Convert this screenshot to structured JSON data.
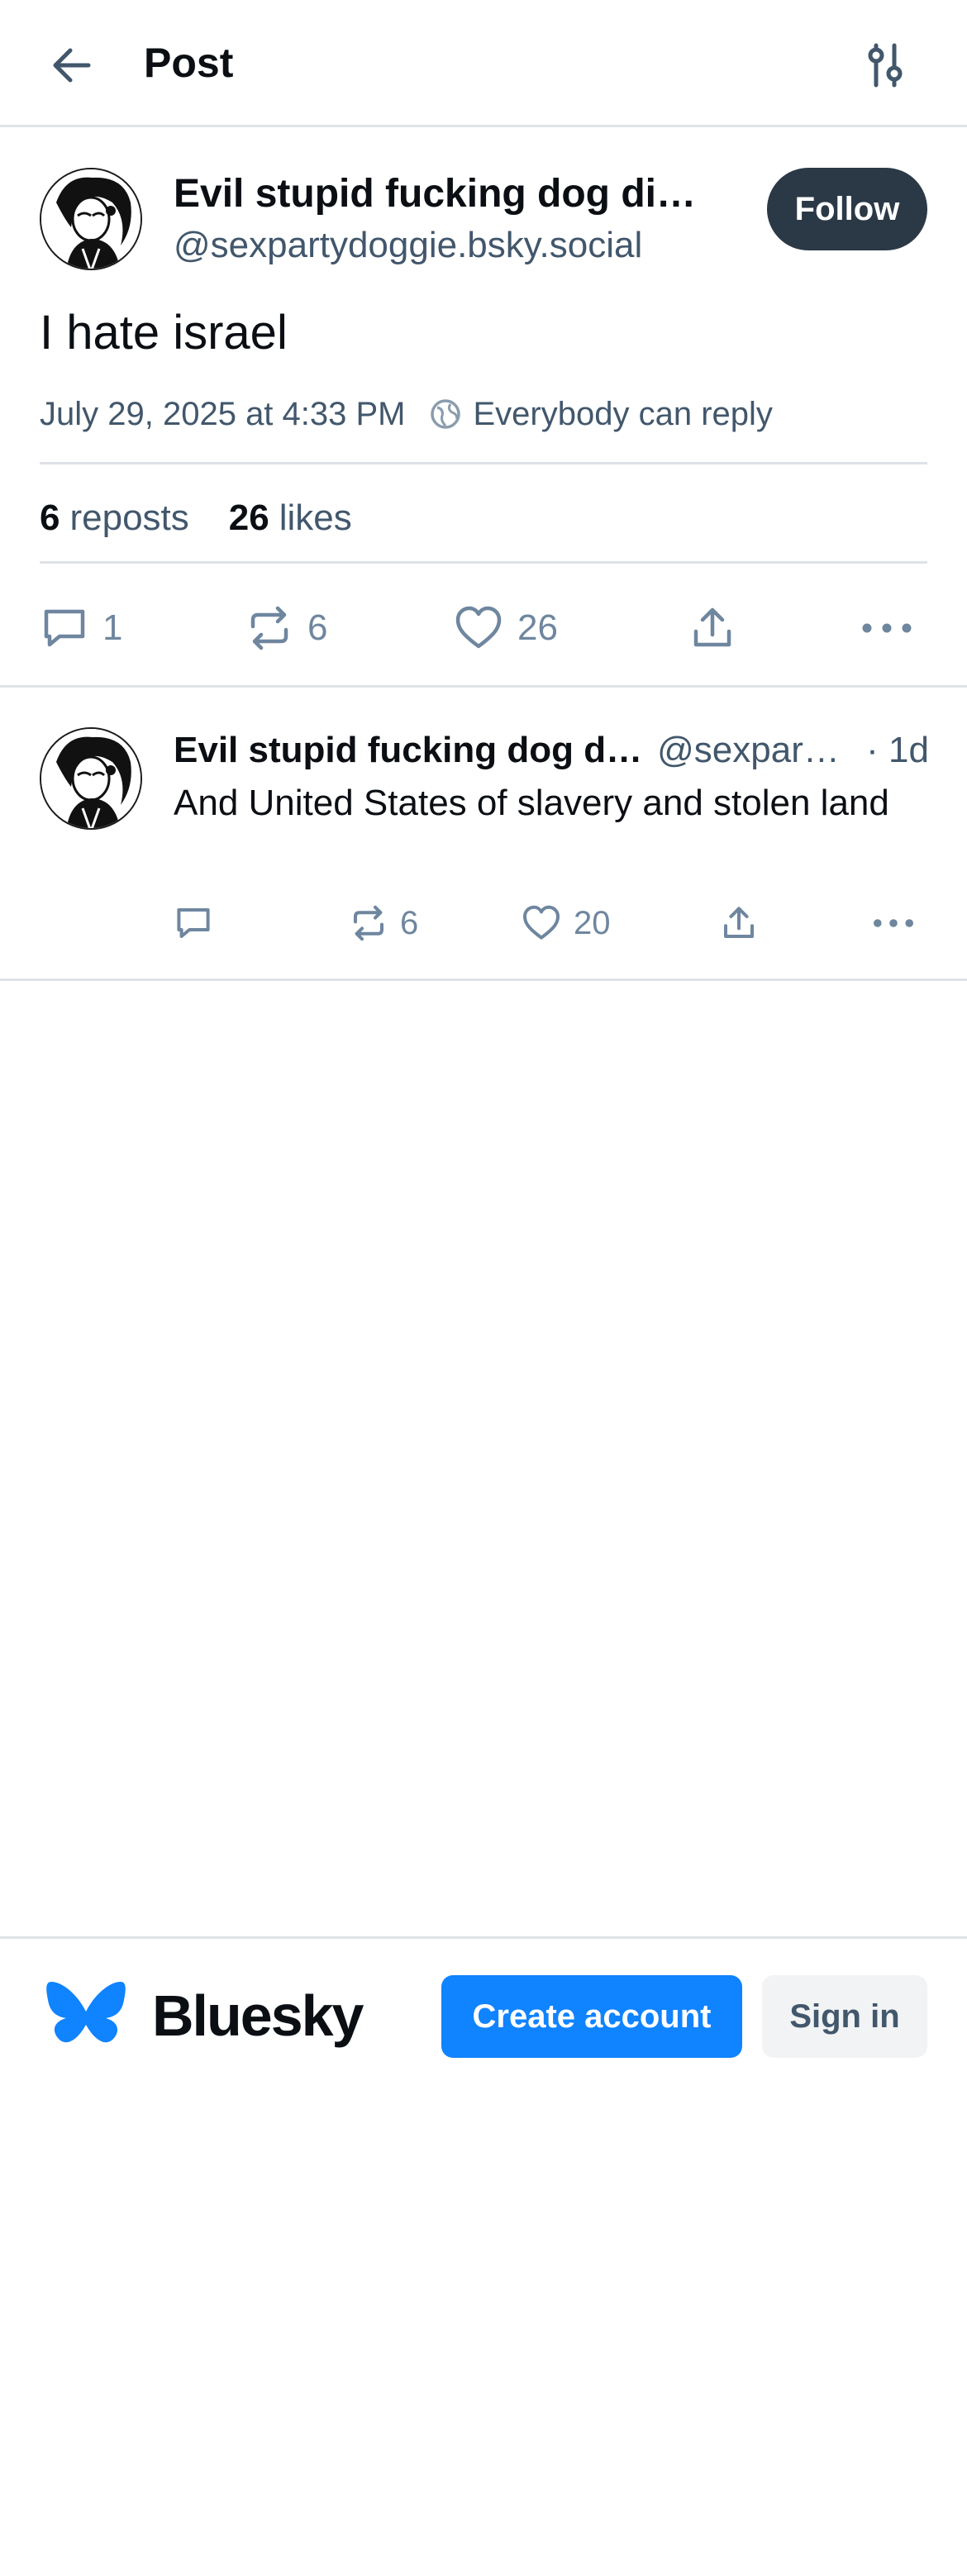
{
  "header": {
    "title": "Post",
    "back_icon": "arrow-left-icon",
    "filter_icon": "sliders-icon"
  },
  "main_post": {
    "author_name": "Evil stupid fucking dog di…",
    "author_handle": "@sexpartydoggie.bsky.social",
    "follow_label": "Follow",
    "text": "I hate israel",
    "timestamp": "July 29, 2025 at 4:33 PM",
    "reply_rule": "Everybody can reply",
    "reposts_count": "6",
    "reposts_label": "reposts",
    "likes_count": "26",
    "likes_label": "likes",
    "actions": {
      "reply_count": "1",
      "repost_count": "6",
      "like_count": "26"
    }
  },
  "reply": {
    "author_name": "Evil stupid fucking dog d…",
    "author_handle": "@sexpar…",
    "time": "· 1d",
    "text": "And United States of slavery and stolen land",
    "actions": {
      "reply_count": "",
      "repost_count": "6",
      "like_count": "20"
    }
  },
  "bottom_bar": {
    "brand": "Bluesky",
    "create_account_label": "Create account",
    "sign_in_label": "Sign in"
  },
  "colors": {
    "accent": "#1083fe",
    "follow_bg": "#2b3947",
    "muted_text": "#42576c",
    "icon_gray": "#6f869f",
    "divider": "#dfe3e8"
  }
}
